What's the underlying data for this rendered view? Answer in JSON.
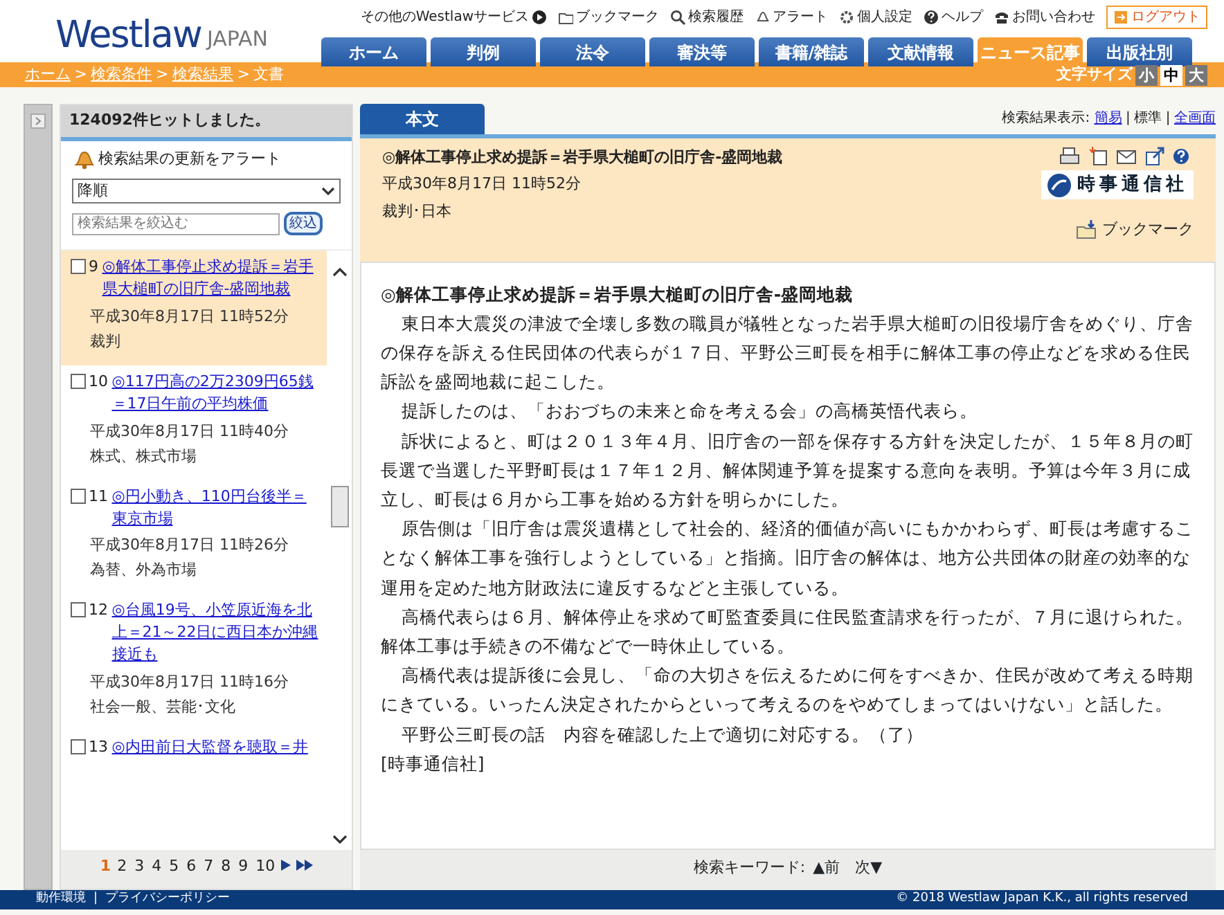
{
  "logo": {
    "name": "Westlaw",
    "sub": "JAPAN"
  },
  "utility_links": [
    {
      "kind": "services",
      "label": "その他のWestlawサービス"
    },
    {
      "kind": "bookmark",
      "label": "ブックマーク"
    },
    {
      "kind": "history",
      "label": "検索履歴"
    },
    {
      "kind": "alert",
      "label": "アラート"
    },
    {
      "kind": "settings",
      "label": "個人設定"
    },
    {
      "kind": "help",
      "label": "ヘルプ"
    },
    {
      "kind": "contact",
      "label": "お問い合わせ"
    },
    {
      "kind": "logout",
      "label": "ログアウト"
    }
  ],
  "tabs": [
    {
      "label": "ホーム",
      "selected": false
    },
    {
      "label": "判例",
      "selected": false
    },
    {
      "label": "法令",
      "selected": false
    },
    {
      "label": "審決等",
      "selected": false
    },
    {
      "label": "書籍/雑誌",
      "selected": false
    },
    {
      "label": "文献情報",
      "selected": false
    },
    {
      "label": "ニュース記事",
      "selected": true
    },
    {
      "label": "出版社別",
      "selected": false
    }
  ],
  "breadcrumb_separator": ">",
  "breadcrumb": [
    {
      "label": "ホーム",
      "link": true
    },
    {
      "label": "検索条件",
      "link": true
    },
    {
      "label": "検索結果",
      "link": true
    },
    {
      "label": "文書",
      "link": false
    }
  ],
  "text_size": {
    "label": "文字サイズ",
    "options": [
      {
        "label": "小",
        "selected": false
      },
      {
        "label": "中",
        "selected": true
      },
      {
        "label": "大",
        "selected": false
      }
    ]
  },
  "results_panel": {
    "hit_count": "124092件ヒットしました。",
    "alert_link": "検索結果の更新をアラート",
    "sort": "降順",
    "filter_placeholder": "検索結果を絞込む",
    "filter_button": "絞込",
    "items": [
      {
        "number": "9",
        "title": "◎解体工事停止求め提訴＝岩手県大槌町の旧庁舎-盛岡地裁",
        "date": "平成30年8月17日 11時52分",
        "category": "裁判",
        "checked": false,
        "selected": true
      },
      {
        "number": "10",
        "title": "◎117円高の2万2309円65銭＝17日午前の平均株価",
        "date": "平成30年8月17日 11時40分",
        "category": "株式、株式市場",
        "checked": false,
        "selected": false
      },
      {
        "number": "11",
        "title": "◎円小動き、110円台後半＝東京市場",
        "date": "平成30年8月17日 11時26分",
        "category": "為替、外為市場",
        "checked": false,
        "selected": false
      },
      {
        "number": "12",
        "title": "◎台風19号、小笠原近海を北上＝21～22日に西日本か沖縄接近も",
        "date": "平成30年8月17日 11時16分",
        "category": "社会一般、芸能･文化",
        "checked": false,
        "selected": false
      },
      {
        "number": "13",
        "title": "◎内田前日大監督を聴取＝井",
        "checked": false,
        "selected": false
      }
    ],
    "pages": [
      {
        "label": "1",
        "selected": true
      },
      {
        "label": "2",
        "selected": false
      },
      {
        "label": "3",
        "selected": false
      },
      {
        "label": "4",
        "selected": false
      },
      {
        "label": "5",
        "selected": false
      },
      {
        "label": "6",
        "selected": false
      },
      {
        "label": "7",
        "selected": false
      },
      {
        "label": "8",
        "selected": false
      },
      {
        "label": "9",
        "selected": false
      },
      {
        "label": "10",
        "selected": false
      }
    ]
  },
  "document": {
    "tab": "本文",
    "display_label": "検索結果表示:",
    "display_separator": "|",
    "display_modes": [
      {
        "label": "簡易",
        "selected": false
      },
      {
        "label": "標準",
        "selected": true
      },
      {
        "label": "全画面",
        "selected": false
      }
    ],
    "title": "◎解体工事停止求め提訴＝岩手県大槌町の旧庁舎-盛岡地裁",
    "date": "平成30年8月17日 11時52分",
    "category": "裁判･日本",
    "source_logo": "時事通信社",
    "bookmark": "ブックマーク",
    "heading": "◎解体工事停止求め提訴＝岩手県大槌町の旧庁舎-盛岡地裁",
    "paragraphs": [
      {
        "kind": "indented",
        "text": "東日本大震災の津波で全壊し多数の職員が犠牲となった岩手県大槌町の旧役場庁舎をめぐり、庁舎の保存を訴える住民団体の代表らが１７日、平野公三町長を相手に解体工事の停止などを求める住民訴訟を盛岡地裁に起こした。"
      },
      {
        "kind": "indented",
        "text": "提訴したのは、「おおづちの未来と命を考える会」の高橋英悟代表ら。"
      },
      {
        "kind": "indented",
        "text": "訴状によると、町は２０１３年４月、旧庁舎の一部を保存する方針を決定したが、１５年８月の町長選で当選した平野町長は１７年１２月、解体関連予算を提案する意向を表明。予算は今年３月に成立し、町長は６月から工事を始める方針を明らかにした。"
      },
      {
        "kind": "indented",
        "text": "原告側は「旧庁舎は震災遺構として社会的、経済的価値が高いにもかかわらず、町長は考慮することなく解体工事を強行しようとしている」と指摘。旧庁舎の解体は、地方公共団体の財産の効率的な運用を定めた地方財政法に違反するなどと主張している。"
      },
      {
        "kind": "indented",
        "text": "高橋代表らは６月、解体停止を求めて町監査委員に住民監査請求を行ったが、７月に退けられた。解体工事は手続きの不備などで一時休止している。"
      },
      {
        "kind": "indented",
        "text": "高橋代表は提訴後に会見し、「命の大切さを伝えるために何をすべきか、住民が改めて考える時期にきている。いったん決定されたからといって考えるのをやめてしまってはいけない」と話した。"
      },
      {
        "kind": "indented",
        "text": "平野公三町長の話　内容を確認した上で適切に対応する。（了）"
      },
      {
        "kind": "plain",
        "text": "[時事通信社]"
      }
    ],
    "keyword_nav": {
      "label": "検索キーワード:",
      "prev": "▲前",
      "next": "次▼"
    }
  },
  "footer": {
    "links": [
      "動作環境",
      "プライバシーポリシー"
    ],
    "separator": "|",
    "copyright": "© 2018 Westlaw Japan K.K., all rights reserved"
  }
}
